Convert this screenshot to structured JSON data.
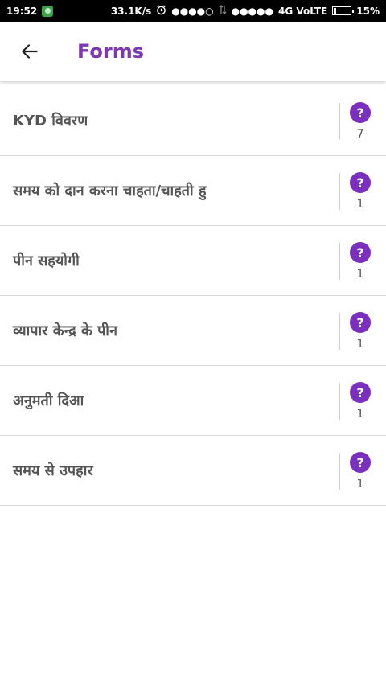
{
  "status_bar": {
    "time": "19:52",
    "network_speed": "33.1K/s",
    "signal_dots_1": "●●●●○",
    "signal_dots_2": "●●●●●",
    "network_type": "4G VoLTE",
    "battery_percent": "15%",
    "battery_level": 0.15
  },
  "app_bar": {
    "title": "Forms"
  },
  "forms": [
    {
      "label": "KYD विवरण",
      "count": "7"
    },
    {
      "label": "समय को दान करना चाहता/चाहती हु",
      "count": "1"
    },
    {
      "label": "पीन सहयोगी",
      "count": "1"
    },
    {
      "label": "व्यापार केन्द्र के पीन",
      "count": "1"
    },
    {
      "label": "अनुमती दिआ",
      "count": "1"
    },
    {
      "label": "समय से उपहार",
      "count": "1"
    }
  ],
  "help_glyph": "?"
}
